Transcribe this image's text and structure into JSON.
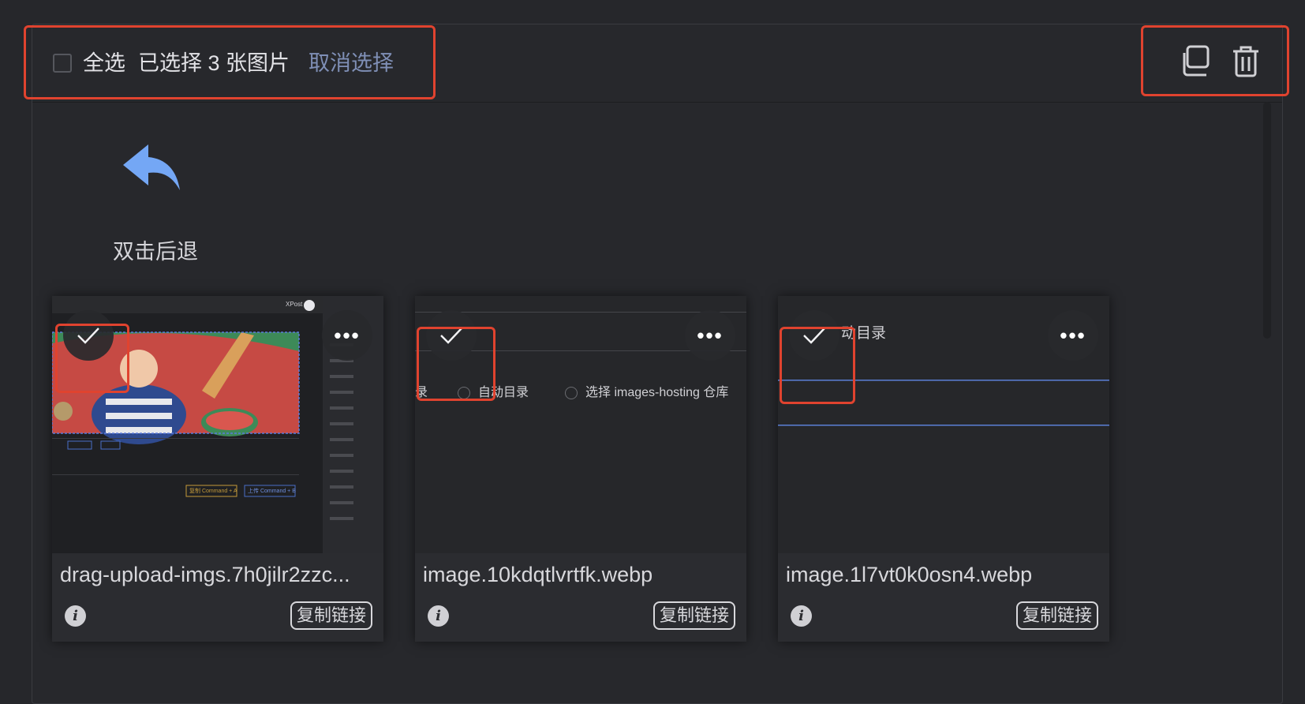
{
  "toolbar": {
    "select_all_label": "全选",
    "selected_info": "已选择 3 张图片",
    "cancel_selection": "取消选择"
  },
  "back": {
    "label": "双击后退"
  },
  "cards": [
    {
      "filename": "drag-upload-imgs.7h0jilr2zzc...",
      "copy_label": "复制链接",
      "selected": true,
      "thumb_text": {
        "app": "XPost",
        "btn1": "复制 Command + A",
        "btn2": "上传 Command + B"
      }
    },
    {
      "filename": "image.10kdqtlvrtfk.webp",
      "copy_label": "复制链接",
      "selected": true,
      "thumb_text": {
        "frag": "录",
        "opt1": "自动目录",
        "opt2": "选择 images-hosting 仓库"
      }
    },
    {
      "filename": "image.1l7vt0k0osn4.webp",
      "copy_label": "复制链接",
      "selected": true,
      "thumb_text": {
        "frag": "动目录"
      }
    }
  ],
  "colors": {
    "highlight": "#e0432f",
    "accent_link": "#7f8fb6",
    "back_icon": "#74a7f5"
  }
}
